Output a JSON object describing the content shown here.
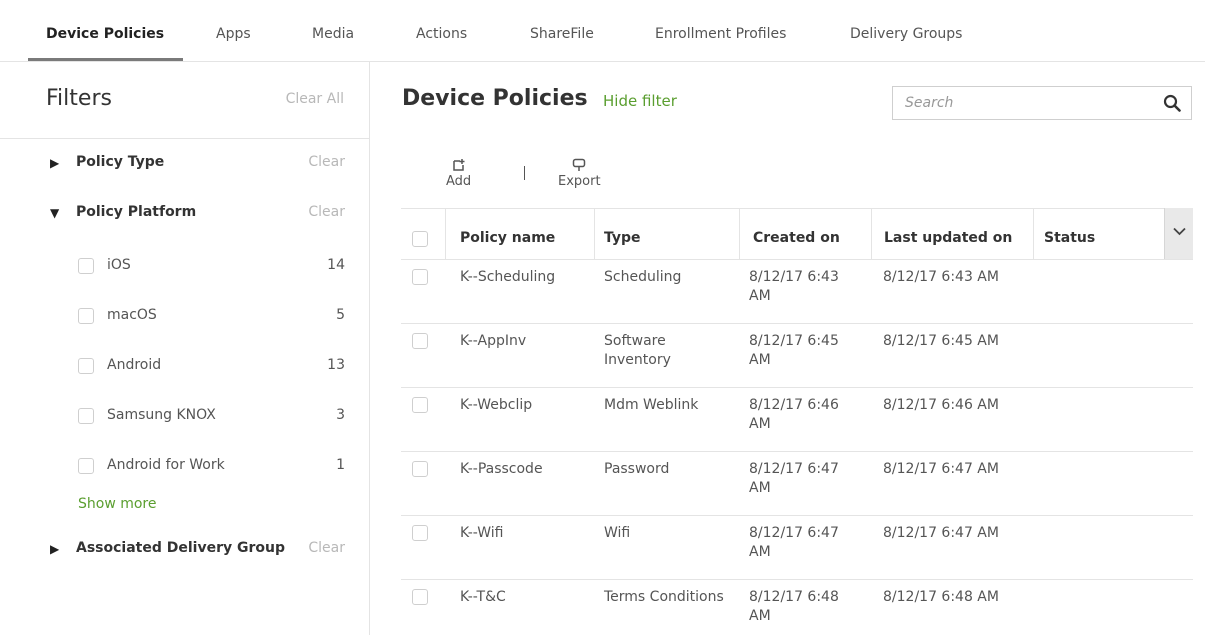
{
  "tabs": [
    "Device Policies",
    "Apps",
    "Media",
    "Actions",
    "ShareFile",
    "Enrollment Profiles",
    "Delivery Groups"
  ],
  "filters": {
    "title": "Filters",
    "clear_all": "Clear All",
    "sections": [
      {
        "label": "Policy Type",
        "clear": "Clear",
        "expanded": false
      },
      {
        "label": "Policy Platform",
        "clear": "Clear",
        "expanded": true
      },
      {
        "label": "Associated Delivery Group",
        "clear": "Clear",
        "expanded": false
      }
    ],
    "platform_options": [
      {
        "label": "iOS",
        "count": "14"
      },
      {
        "label": "macOS",
        "count": "5"
      },
      {
        "label": "Android",
        "count": "13"
      },
      {
        "label": "Samsung KNOX",
        "count": "3"
      },
      {
        "label": "Android for Work",
        "count": "1"
      }
    ],
    "show_more": "Show more"
  },
  "main": {
    "title": "Device Policies",
    "hide_filter": "Hide filter",
    "search_placeholder": "Search",
    "actions": {
      "add": "Add",
      "export": "Export"
    }
  },
  "table": {
    "columns": [
      "Policy name",
      "Type",
      "Created on",
      "Last updated on",
      "Status"
    ],
    "rows": [
      {
        "name": "K--Scheduling",
        "type": "Scheduling",
        "created": "8/12/17 6:43 AM",
        "updated": "8/12/17 6:43 AM",
        "status": ""
      },
      {
        "name": "K--AppInv",
        "type": "Software Inventory",
        "created": "8/12/17 6:45 AM",
        "updated": "8/12/17 6:45 AM",
        "status": ""
      },
      {
        "name": "K--Webclip",
        "type": "Mdm Weblink",
        "created": "8/12/17 6:46 AM",
        "updated": "8/12/17 6:46 AM",
        "status": ""
      },
      {
        "name": "K--Passcode",
        "type": "Password",
        "created": "8/12/17 6:47 AM",
        "updated": "8/12/17 6:47 AM",
        "status": ""
      },
      {
        "name": "K--Wifi",
        "type": "Wifi",
        "created": "8/12/17 6:47 AM",
        "updated": "8/12/17 6:47 AM",
        "status": ""
      },
      {
        "name": "K--T&C",
        "type": "Terms Conditions",
        "created": "8/12/17 6:48 AM",
        "updated": "8/12/17 6:48 AM",
        "status": ""
      }
    ]
  },
  "colors": {
    "accent_green": "#5a9e2f",
    "muted": "#b8b8b8",
    "border": "#e4e4e4"
  }
}
